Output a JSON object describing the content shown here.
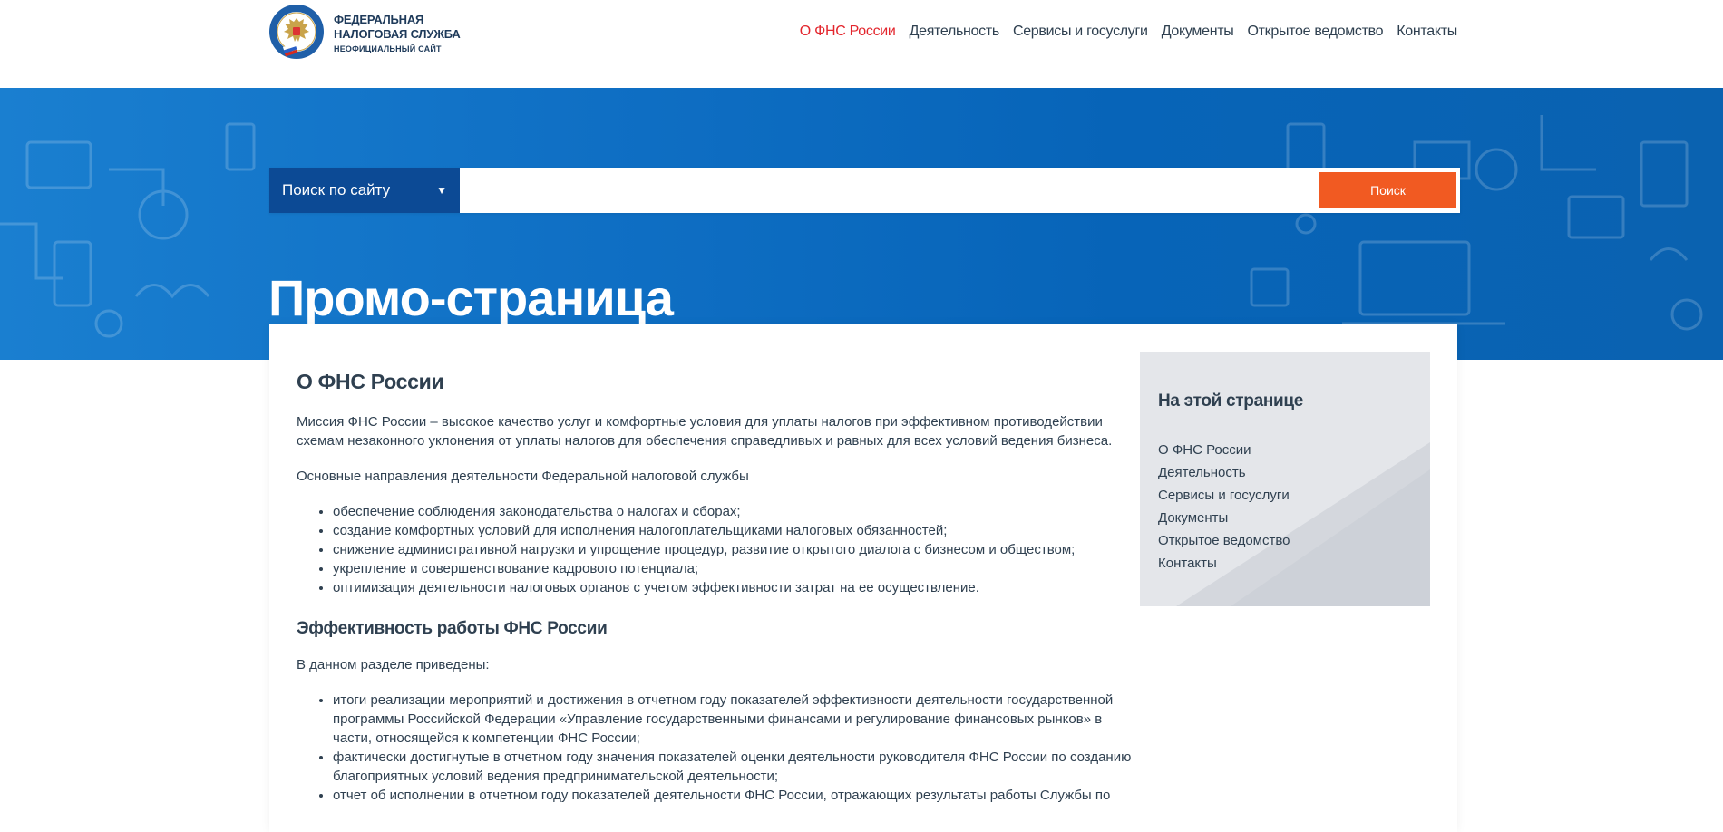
{
  "header": {
    "logo": {
      "line1": "ФЕДЕРАЛЬНАЯ",
      "line2": "НАЛОГОВАЯ СЛУЖБА",
      "line3": "НЕОФИЦИАЛЬНЫЙ САЙТ",
      "emblem_ring_text": "ФЕДЕРАЛЬНАЯ НАЛОГОВАЯ СЛУЖБА"
    },
    "nav": [
      {
        "label": "О ФНС России",
        "active": true
      },
      {
        "label": "Деятельность",
        "active": false
      },
      {
        "label": "Сервисы и госуслуги",
        "active": false
      },
      {
        "label": "Документы",
        "active": false
      },
      {
        "label": "Открытое ведомство",
        "active": false
      },
      {
        "label": "Контакты",
        "active": false
      }
    ]
  },
  "search": {
    "select_value": "Поиск по сайту",
    "input_value": "",
    "input_placeholder": "",
    "button_label": "Поиск"
  },
  "hero": {
    "title": "Промо-страница"
  },
  "article": {
    "heading": "О ФНС России",
    "mission": "Миссия ФНС России – высокое качество услуг и комфортные условия для уплаты налогов при эффективном противодействии схемам незаконного уклонения от уплаты налогов для обеспечения справедливых и равных для всех условий ведения бизнеса.",
    "directions_intro": "Основные направления деятельности Федеральной налоговой службы",
    "directions": [
      "обеспечение соблюдения законодательства о налогах и сборах;",
      "создание комфортных условий для исполнения налогоплательщиками налоговых обязанностей;",
      "снижение административной нагрузки и упрощение процедур, развитие открытого диалога с бизнесом и обществом;",
      "укрепление и совершенствование кадрового потенциала;",
      "оптимизация деятельности налоговых органов с учетом эффективности затрат на ее осуществление."
    ],
    "efficiency_heading": "Эффективность работы ФНС России",
    "efficiency_intro": "В данном разделе приведены:",
    "efficiency_items": [
      "итоги реализации мероприятий и достижения в отчетном году показателей эффективности деятельности государственной программы Российской Федерации «Управление государственными финансами и регулирование финансовых рынков» в части, относящейся к компетенции ФНС России;",
      "фактически достигнутые в отчетном году значения показателей оценки деятельности руководителя ФНС России по созданию благоприятных условий ведения предпринимательской деятельности;",
      "отчет об исполнении в отчетном году показателей деятельности ФНС России, отражающих результаты работы Службы по"
    ]
  },
  "toc": {
    "title": "На этой странице",
    "items": [
      "О ФНС России",
      "Деятельность",
      "Сервисы и госуслуги",
      "Документы",
      "Открытое ведомство",
      "Контакты"
    ]
  },
  "colors": {
    "nav_active": "#e3262d",
    "text": "#2f4050",
    "hero_blue": "#0f6fc4",
    "select_blue": "#0c4a95",
    "search_button": "#f15a22",
    "toc_bg": "#e4e6ea"
  },
  "icons": {
    "emblem": "fns-emblem-icon",
    "select_chevron": "chevron-down-icon"
  }
}
